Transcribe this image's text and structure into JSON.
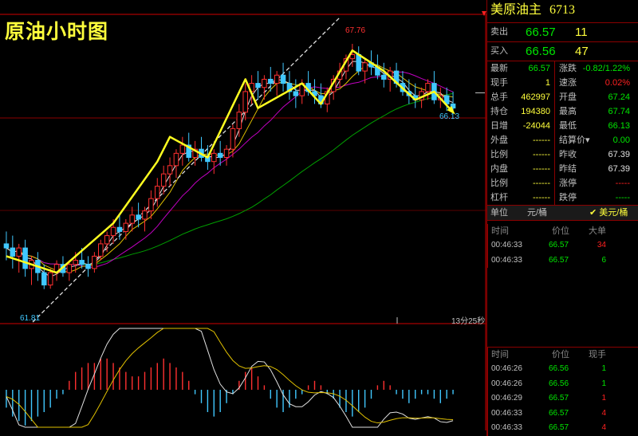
{
  "chart_data": {
    "type": "candlestick",
    "title": "原油小时图",
    "ylim": [
      61.0,
      68.4
    ],
    "annotations": {
      "high": "67.76",
      "low": "61.81",
      "last": "66.13",
      "countdown": "13分25秒"
    },
    "ohlc": [
      [
        62.9,
        63.2,
        62.5,
        62.8
      ],
      [
        62.8,
        63.1,
        62.3,
        62.6
      ],
      [
        62.6,
        62.9,
        62.2,
        62.8
      ],
      [
        62.8,
        63.0,
        62.1,
        62.3
      ],
      [
        62.3,
        62.6,
        61.9,
        62.5
      ],
      [
        62.5,
        62.7,
        62.0,
        62.2
      ],
      [
        62.2,
        62.4,
        61.8,
        61.9
      ],
      [
        61.9,
        62.3,
        61.81,
        62.2
      ],
      [
        62.2,
        62.5,
        62.0,
        62.4
      ],
      [
        62.4,
        62.6,
        62.1,
        62.2
      ],
      [
        62.2,
        62.5,
        62.0,
        62.4
      ],
      [
        62.4,
        62.7,
        62.2,
        62.5
      ],
      [
        62.5,
        62.8,
        62.3,
        62.4
      ],
      [
        62.4,
        62.6,
        62.1,
        62.3
      ],
      [
        62.3,
        62.7,
        62.2,
        62.6
      ],
      [
        62.6,
        63.0,
        62.5,
        62.9
      ],
      [
        62.9,
        63.2,
        62.7,
        63.1
      ],
      [
        63.1,
        63.5,
        62.9,
        63.3
      ],
      [
        63.3,
        63.6,
        63.0,
        63.2
      ],
      [
        63.2,
        63.5,
        63.0,
        63.4
      ],
      [
        63.4,
        63.8,
        63.2,
        63.6
      ],
      [
        63.6,
        63.9,
        63.3,
        63.5
      ],
      [
        63.5,
        63.8,
        63.2,
        63.7
      ],
      [
        63.7,
        64.2,
        63.5,
        64.0
      ],
      [
        64.0,
        64.5,
        63.8,
        64.3
      ],
      [
        64.3,
        64.8,
        64.1,
        64.6
      ],
      [
        64.6,
        65.0,
        64.3,
        64.8
      ],
      [
        64.8,
        65.2,
        64.5,
        65.1
      ],
      [
        65.1,
        65.5,
        64.8,
        65.3
      ],
      [
        65.3,
        65.6,
        64.9,
        65.0
      ],
      [
        65.0,
        65.4,
        64.8,
        65.2
      ],
      [
        65.2,
        65.5,
        64.9,
        65.0
      ],
      [
        65.0,
        65.3,
        64.7,
        64.9
      ],
      [
        64.9,
        65.2,
        64.6,
        65.1
      ],
      [
        65.1,
        65.4,
        64.8,
        65.0
      ],
      [
        65.0,
        65.3,
        64.8,
        65.2
      ],
      [
        65.2,
        65.8,
        65.0,
        65.7
      ],
      [
        65.7,
        66.3,
        65.5,
        66.1
      ],
      [
        66.1,
        66.8,
        65.9,
        66.6
      ],
      [
        66.6,
        67.0,
        66.3,
        66.8
      ],
      [
        66.8,
        67.1,
        66.4,
        66.7
      ],
      [
        66.7,
        67.0,
        66.4,
        66.9
      ],
      [
        66.9,
        67.2,
        66.6,
        66.8
      ],
      [
        66.8,
        67.1,
        66.5,
        67.0
      ],
      [
        67.0,
        67.3,
        66.6,
        66.8
      ],
      [
        66.8,
        67.1,
        66.4,
        66.6
      ],
      [
        66.6,
        66.9,
        66.2,
        66.5
      ],
      [
        66.5,
        66.9,
        66.3,
        66.8
      ],
      [
        66.8,
        67.1,
        66.5,
        66.6
      ],
      [
        66.6,
        66.9,
        66.3,
        66.5
      ],
      [
        66.5,
        66.8,
        66.2,
        66.3
      ],
      [
        66.3,
        66.7,
        66.1,
        66.6
      ],
      [
        66.6,
        67.0,
        66.4,
        66.9
      ],
      [
        66.9,
        67.3,
        66.7,
        67.1
      ],
      [
        67.1,
        67.5,
        66.9,
        67.4
      ],
      [
        67.4,
        67.76,
        67.2,
        67.5
      ],
      [
        67.5,
        67.7,
        67.0,
        67.1
      ],
      [
        67.1,
        67.4,
        66.8,
        67.3
      ],
      [
        67.3,
        67.6,
        67.0,
        67.2
      ],
      [
        67.2,
        67.5,
        66.9,
        67.0
      ],
      [
        67.0,
        67.3,
        66.7,
        66.9
      ],
      [
        66.9,
        67.2,
        66.6,
        67.1
      ],
      [
        67.1,
        67.3,
        66.7,
        66.8
      ],
      [
        66.8,
        67.1,
        66.5,
        66.6
      ],
      [
        66.6,
        66.9,
        66.3,
        66.5
      ],
      [
        66.5,
        66.8,
        66.2,
        66.4
      ],
      [
        66.4,
        66.7,
        66.2,
        66.6
      ],
      [
        66.6,
        66.9,
        66.4,
        66.8
      ],
      [
        66.8,
        67.1,
        66.3,
        66.4
      ],
      [
        66.4,
        66.7,
        66.2,
        66.5
      ],
      [
        66.5,
        66.7,
        66.13,
        66.3
      ],
      [
        66.3,
        66.6,
        66.13,
        66.2
      ]
    ],
    "arrows": [
      [
        [
          0,
          62.6
        ],
        [
          8,
          62.2
        ],
        [
          17,
          63.4
        ],
        [
          24,
          64.9
        ],
        [
          26,
          65.5
        ],
        [
          32,
          65.0
        ],
        [
          38,
          66.9
        ],
        [
          40,
          66.2
        ],
        [
          47,
          66.8
        ],
        [
          50,
          66.3
        ],
        [
          55,
          67.6
        ],
        [
          60,
          67.1
        ],
        [
          65,
          66.4
        ],
        [
          68,
          66.6
        ],
        [
          71,
          66.1
        ]
      ]
    ],
    "macd_hist": [
      -4,
      -6,
      -7,
      -8,
      -7,
      -6,
      -5,
      -4,
      -2,
      -1,
      2,
      4,
      5,
      6,
      6,
      7,
      7,
      6,
      5,
      4,
      3,
      3,
      4,
      5,
      6,
      7,
      6,
      5,
      4,
      2,
      -1,
      -3,
      -5,
      -6,
      -5,
      -3,
      -1,
      2,
      4,
      5,
      3,
      1,
      -2,
      -4,
      -5,
      -4,
      -2,
      -1,
      1,
      2,
      1,
      -1,
      -2,
      -4,
      -5,
      -6,
      -5,
      -4,
      -2,
      1,
      2,
      1,
      -1,
      -2,
      -3,
      -2,
      -1,
      -1,
      -2,
      -3,
      -2,
      -1
    ]
  },
  "panel": {
    "name": "美原油主",
    "code": "6713",
    "sell": {
      "label": "卖出",
      "price": "66.57",
      "vol": "11"
    },
    "buy": {
      "label": "买入",
      "price": "66.56",
      "vol": "47"
    },
    "stats": [
      {
        "l1": "最新",
        "v1": "66.57",
        "c1": "green",
        "l2": "涨跌",
        "v2": "-0.82/1.22%",
        "c2": "green"
      },
      {
        "l1": "现手",
        "v1": "1",
        "c1": "yellow",
        "l2": "速涨",
        "v2": "0.02%",
        "c2": "red"
      },
      {
        "l1": "总手",
        "v1": "462997",
        "c1": "yellow",
        "l2": "开盘",
        "v2": "67.24",
        "c2": "green"
      },
      {
        "l1": "持仓",
        "v1": "194380",
        "c1": "yellow",
        "l2": "最高",
        "v2": "67.74",
        "c2": "green"
      },
      {
        "l1": "日增",
        "v1": "-24044",
        "c1": "yellow",
        "l2": "最低",
        "v2": "66.13",
        "c2": "green"
      },
      {
        "l1": "外盘",
        "v1": "------",
        "c1": "yellow",
        "l2": "结算价▾",
        "v2": "0.00",
        "c2": "green"
      },
      {
        "l1": "比例",
        "v1": "------",
        "c1": "yellow",
        "l2": "昨收",
        "v2": "67.39",
        "c2": "white"
      },
      {
        "l1": "内盘",
        "v1": "------",
        "c1": "yellow",
        "l2": "昨结",
        "v2": "67.39",
        "c2": "white"
      },
      {
        "l1": "比例",
        "v1": "------",
        "c1": "yellow",
        "l2": "涨停",
        "v2": "-----",
        "c2": "red"
      },
      {
        "l1": "杠杆",
        "v1": "------",
        "c1": "yellow",
        "l2": "跌停",
        "v2": "-----",
        "c2": "green"
      }
    ],
    "units": {
      "label": "单位",
      "unit1": "元/桶",
      "unit2": "✔ 美元/桶"
    },
    "big_orders": {
      "headers": [
        "时间",
        "价位",
        "大单"
      ],
      "rows": [
        {
          "time": "00:46:33",
          "price": "66.57",
          "vol": "34",
          "c": "red"
        },
        {
          "time": "00:46:33",
          "price": "66.57",
          "vol": "6",
          "c": "green"
        }
      ]
    },
    "ticks": {
      "headers": [
        "时间",
        "价位",
        "现手"
      ],
      "rows": [
        {
          "time": "00:46:26",
          "price": "66.56",
          "vol": "1",
          "c": "green"
        },
        {
          "time": "00:46:26",
          "price": "66.56",
          "vol": "1",
          "c": "green"
        },
        {
          "time": "00:46:29",
          "price": "66.57",
          "vol": "1",
          "c": "red"
        },
        {
          "time": "00:46:33",
          "price": "66.57",
          "vol": "4",
          "c": "red"
        },
        {
          "time": "00:46:33",
          "price": "66.57",
          "vol": "4",
          "c": "red"
        }
      ]
    }
  }
}
